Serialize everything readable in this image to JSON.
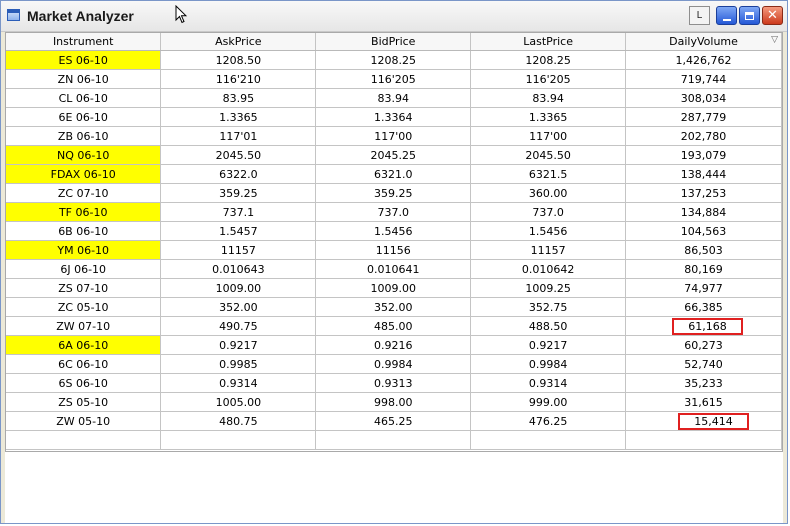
{
  "window": {
    "title": "Market Analyzer",
    "link_button_label": "L"
  },
  "grid": {
    "columns": [
      "Instrument",
      "AskPrice",
      "BidPrice",
      "LastPrice",
      "DailyVolume"
    ],
    "rows": [
      {
        "instrument": "ES 06-10",
        "ask": "1208.50",
        "bid": "1208.25",
        "last": "1208.25",
        "volume": "1,426,762",
        "highlight": true
      },
      {
        "instrument": "ZN 06-10",
        "ask": "116'210",
        "bid": "116'205",
        "last": "116'205",
        "volume": "719,744"
      },
      {
        "instrument": "CL 06-10",
        "ask": "83.95",
        "bid": "83.94",
        "last": "83.94",
        "volume": "308,034"
      },
      {
        "instrument": "6E 06-10",
        "ask": "1.3365",
        "bid": "1.3364",
        "last": "1.3365",
        "volume": "287,779"
      },
      {
        "instrument": "ZB 06-10",
        "ask": "117'01",
        "bid": "117'00",
        "last": "117'00",
        "volume": "202,780"
      },
      {
        "instrument": "NQ 06-10",
        "ask": "2045.50",
        "bid": "2045.25",
        "last": "2045.50",
        "volume": "193,079",
        "highlight": true
      },
      {
        "instrument": "FDAX 06-10",
        "ask": "6322.0",
        "bid": "6321.0",
        "last": "6321.5",
        "volume": "138,444",
        "highlight": true
      },
      {
        "instrument": "ZC 07-10",
        "ask": "359.25",
        "bid": "359.25",
        "last": "360.00",
        "volume": "137,253"
      },
      {
        "instrument": "TF 06-10",
        "ask": "737.1",
        "bid": "737.0",
        "last": "737.0",
        "volume": "134,884",
        "highlight": true
      },
      {
        "instrument": "6B 06-10",
        "ask": "1.5457",
        "bid": "1.5456",
        "last": "1.5456",
        "volume": "104,563"
      },
      {
        "instrument": "YM 06-10",
        "ask": "11157",
        "bid": "11156",
        "last": "11157",
        "volume": "86,503",
        "highlight": true
      },
      {
        "instrument": "6J 06-10",
        "ask": "0.010643",
        "bid": "0.010641",
        "last": "0.010642",
        "volume": "80,169"
      },
      {
        "instrument": "ZS 07-10",
        "ask": "1009.00",
        "bid": "1009.00",
        "last": "1009.25",
        "volume": "74,977"
      },
      {
        "instrument": "ZC 05-10",
        "ask": "352.00",
        "bid": "352.00",
        "last": "352.75",
        "volume": "66,385"
      },
      {
        "instrument": "ZW 07-10",
        "ask": "490.75",
        "bid": "485.00",
        "last": "488.50",
        "volume": "61,168",
        "marked": "a"
      },
      {
        "instrument": "6A 06-10",
        "ask": "0.9217",
        "bid": "0.9216",
        "last": "0.9217",
        "volume": "60,273",
        "highlight": true
      },
      {
        "instrument": "6C 06-10",
        "ask": "0.9985",
        "bid": "0.9984",
        "last": "0.9984",
        "volume": "52,740"
      },
      {
        "instrument": "6S 06-10",
        "ask": "0.9314",
        "bid": "0.9313",
        "last": "0.9314",
        "volume": "35,233"
      },
      {
        "instrument": "ZS 05-10",
        "ask": "1005.00",
        "bid": "998.00",
        "last": "999.00",
        "volume": "31,615"
      },
      {
        "instrument": "ZW 05-10",
        "ask": "480.75",
        "bid": "465.25",
        "last": "476.25",
        "volume": "15,414",
        "marked": "b"
      }
    ]
  },
  "colors": {
    "highlight": "#ffff00",
    "annotation": "#e02020"
  }
}
